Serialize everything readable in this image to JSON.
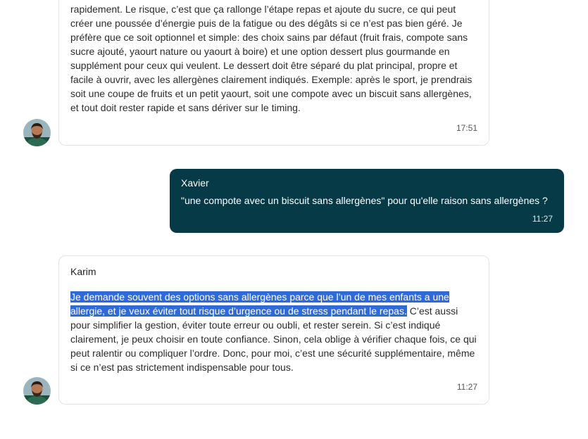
{
  "messages": [
    {
      "sender": "",
      "text": "rapidement. Le risque, c’est que ça rallonge l’étape repas et ajoute du sucre, ce qui peut créer une poussée d’énergie puis de la fatigue ou des dégâts si ce n’est pas bien géré. Je préfère que ce soit optionnel et simple: des choix sains par défaut (fruit frais, compote sans sucre ajouté, yaourt nature ou yaourt à boire) et une option dessert plus gourmande en supplément pour ceux qui veulent. Le dessert doit être séparé du plat principal, propre et facile à ouvrir, avec les allergènes clairement indiqués. Exemple: après le sport, je prendrais soit une coupe de fruits et un petit yaourt, soit une compote avec un biscuit sans allergènes, et tout doit rester rapide et sans dériver sur le timing.",
      "time": "17:51"
    },
    {
      "sender": "Xavier",
      "text": "\"une compote avec un biscuit sans allergènes\" pour qu'elle raison sans allergènes ?",
      "time": "11:27"
    },
    {
      "sender": "Karim",
      "highlighted": "Je demande souvent des options sans allergènes parce que l’un de mes enfants a une allergie, et je veux éviter tout risque d’urgence ou de stress pendant le repas.",
      "text": " C’est aussi pour simplifier la gestion, éviter toute erreur ou oubli, et rester serein. Si c’est indiqué clairement, je peux choisir en toute confiance. Sinon, cela oblige à vérifier chaque fois, ce qui peut ralentir ou compliquer l’ordre. Donc, pour moi, c’est une sécurité supplémentaire, même si ce n’est pas strictement indispensable pour tous.",
      "time": "11:27"
    }
  ],
  "colors": {
    "outgoing_bubble": "#063a47",
    "selection": "#2f6bd8"
  }
}
